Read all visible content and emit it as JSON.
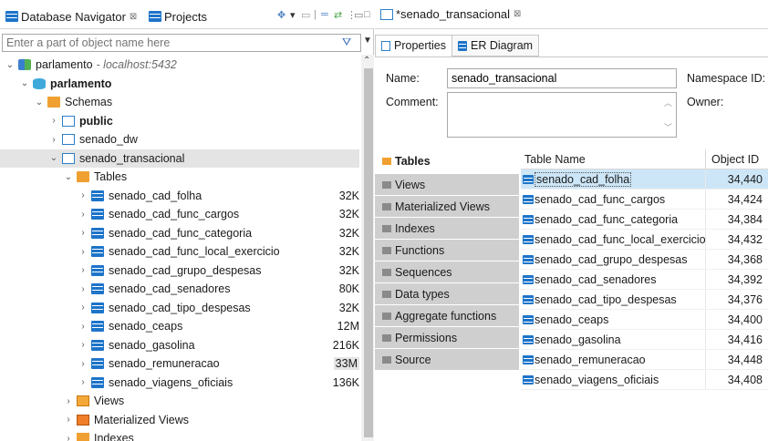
{
  "left_panel": {
    "tabs": [
      {
        "label": "Database Navigator",
        "close": "⊠"
      },
      {
        "label": "Projects"
      }
    ],
    "filter_placeholder": "Enter a part of object name here",
    "tree": [
      {
        "label": "parlamento",
        "suffix": "- localhost:5432",
        "icon": "connection-icon",
        "twisty": "⌄",
        "level": 0
      },
      {
        "label": "parlamento",
        "icon": "database-icon",
        "twisty": "⌄",
        "level": 1,
        "bold": true
      },
      {
        "label": "Schemas",
        "icon": "folder-icon",
        "twisty": "⌄",
        "level": 2
      },
      {
        "label": "public",
        "icon": "schema-icon",
        "twisty": "›",
        "level": 3,
        "bold": true
      },
      {
        "label": "senado_dw",
        "icon": "schema-icon",
        "twisty": "›",
        "level": 3
      },
      {
        "label": "senado_transacional",
        "icon": "schema-icon",
        "twisty": "⌄",
        "level": 3,
        "selected": true
      },
      {
        "label": "Tables",
        "icon": "folder-icon",
        "twisty": "⌄",
        "level": 4
      },
      {
        "label": "senado_cad_folha",
        "icon": "table-icon",
        "twisty": "›",
        "level": 5,
        "size": "32K"
      },
      {
        "label": "senado_cad_func_cargos",
        "icon": "table-icon",
        "twisty": "›",
        "level": 5,
        "size": "32K"
      },
      {
        "label": "senado_cad_func_categoria",
        "icon": "table-icon",
        "twisty": "›",
        "level": 5,
        "size": "32K"
      },
      {
        "label": "senado_cad_func_local_exercicio",
        "icon": "table-icon",
        "twisty": "›",
        "level": 5,
        "size": "32K"
      },
      {
        "label": "senado_cad_grupo_despesas",
        "icon": "table-icon",
        "twisty": "›",
        "level": 5,
        "size": "32K"
      },
      {
        "label": "senado_cad_senadores",
        "icon": "table-icon",
        "twisty": "›",
        "level": 5,
        "size": "80K"
      },
      {
        "label": "senado_cad_tipo_despesas",
        "icon": "table-icon",
        "twisty": "›",
        "level": 5,
        "size": "32K"
      },
      {
        "label": "senado_ceaps",
        "icon": "table-icon",
        "twisty": "›",
        "level": 5,
        "size": "12M"
      },
      {
        "label": "senado_gasolina",
        "icon": "table-icon",
        "twisty": "›",
        "level": 5,
        "size": "216K"
      },
      {
        "label": "senado_remuneracao",
        "icon": "table-icon",
        "twisty": "›",
        "level": 5,
        "size": "33M"
      },
      {
        "label": "senado_viagens_oficiais",
        "icon": "table-icon",
        "twisty": "›",
        "level": 5,
        "size": "136K"
      },
      {
        "label": "Views",
        "icon": "views-icon",
        "twisty": "›",
        "level": 4
      },
      {
        "label": "Materialized Views",
        "icon": "materialized-views-icon",
        "twisty": "›",
        "level": 4
      },
      {
        "label": "Indexes",
        "icon": "indexes-icon",
        "twisty": "›",
        "level": 4
      }
    ]
  },
  "editor": {
    "tab_label": "*senado_transacional",
    "tab_close": "⊠",
    "subtabs": [
      "Properties",
      "ER Diagram"
    ],
    "name_label": "Name:",
    "name_value": "senado_transacional",
    "namespace_label": "Namespace ID:",
    "comment_label": "Comment:",
    "owner_label": "Owner:",
    "vtabs": [
      "Tables",
      "Views",
      "Materialized Views",
      "Indexes",
      "Functions",
      "Sequences",
      "Data types",
      "Aggregate functions",
      "Permissions",
      "Source"
    ],
    "grid_headers": [
      "Table Name",
      "Object ID"
    ],
    "grid_rows": [
      {
        "name": "senado_cad_folha",
        "oid": "34,440"
      },
      {
        "name": "senado_cad_func_cargos",
        "oid": "34,424"
      },
      {
        "name": "senado_cad_func_categoria",
        "oid": "34,384"
      },
      {
        "name": "senado_cad_func_local_exercicio",
        "oid": "34,432"
      },
      {
        "name": "senado_cad_grupo_despesas",
        "oid": "34,368"
      },
      {
        "name": "senado_cad_senadores",
        "oid": "34,392"
      },
      {
        "name": "senado_cad_tipo_despesas",
        "oid": "34,376"
      },
      {
        "name": "senado_ceaps",
        "oid": "34,400"
      },
      {
        "name": "senado_gasolina",
        "oid": "34,416"
      },
      {
        "name": "senado_remuneracao",
        "oid": "34,448"
      },
      {
        "name": "senado_viagens_oficiais",
        "oid": "34,408"
      }
    ]
  }
}
